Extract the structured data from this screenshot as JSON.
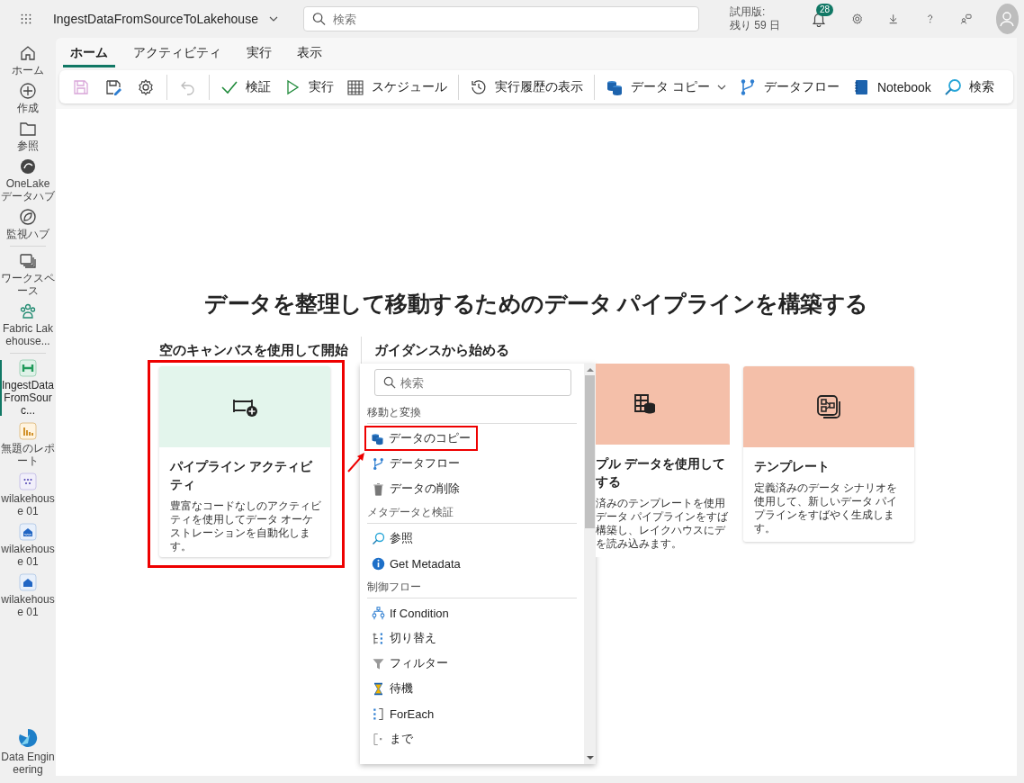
{
  "header": {
    "app_title": "IngestDataFromSourceToLakehouse",
    "search": {
      "placeholder": "検索"
    },
    "trial": [
      "試用版:",
      "残り 59 日"
    ],
    "notifications": "28"
  },
  "sidebar": {
    "items": [
      {
        "label": "ホーム",
        "selected": false
      },
      {
        "label": "作成",
        "selected": false
      },
      {
        "label": "参照",
        "selected": false
      },
      {
        "label": "OneLake データハブ",
        "selected": false
      },
      {
        "label": "監視ハブ",
        "selected": false
      },
      {
        "label": "ワークスペース",
        "selected": false
      },
      {
        "label": "Fabric Lakehouse...",
        "selected": false
      },
      {
        "label": "IngestDataFromSourc...",
        "selected": true
      },
      {
        "label": "無題のレポート",
        "selected": false
      },
      {
        "label": "wilakehouse 01",
        "selected": false
      },
      {
        "label": "wilakehouse 01",
        "selected": false
      },
      {
        "label": "wilakehouse 01",
        "selected": false
      }
    ],
    "footer": {
      "label": "Data Engineering"
    }
  },
  "tabs": [
    {
      "label": "ホーム",
      "selected": true
    },
    {
      "label": "アクティビティ",
      "selected": false
    },
    {
      "label": "実行",
      "selected": false
    },
    {
      "label": "表示",
      "selected": false
    }
  ],
  "toolbar": {
    "icon_buttons": [
      {
        "disabled": true
      },
      {
        "disabled": false
      },
      {
        "disabled": false
      },
      {
        "disabled": true
      }
    ],
    "buttons": [
      {
        "label": "検証",
        "has_menu": false
      },
      {
        "label": "実行",
        "has_menu": false
      },
      {
        "label": "スケジュール",
        "has_menu": false
      },
      {
        "label": "実行履歴の表示",
        "has_menu": false
      },
      {
        "label": "データ コピー",
        "has_menu": true
      },
      {
        "label": "データフロー",
        "has_menu": false
      },
      {
        "label": "Notebook",
        "has_menu": false
      },
      {
        "label": "検索",
        "has_menu": false
      }
    ]
  },
  "canvas": {
    "heading": "データを整理して移動するためのデータ パイプラインを構築する",
    "left_heading": "空のキャンバスを使用して開始",
    "right_heading": "ガイダンスから始める",
    "cards": [
      {
        "title": [
          "パイプライン アクティビティ"
        ],
        "description": [
          "豊富なコードなしのアクティビティを使用してデータ オーケストレーションを自動化します。"
        ],
        "color": "#e3f5ec",
        "highlighted": true,
        "cut": false
      },
      {
        "title": [
          "プル データを使用して",
          "する"
        ],
        "description": [
          "済みのテンプレートを使用",
          "データ パイプラインをすば",
          "構築し、レイクハウスにデ",
          "を読み込みます。"
        ],
        "color": "#f4bfa9",
        "highlighted": false,
        "cut": true
      },
      {
        "title": [
          "テンプレート"
        ],
        "description": [
          "定義済みのデータ シナリオを使用して、新しいデータ パイプラインをすばやく生成します。"
        ],
        "color": "#f4bfa9",
        "highlighted": false,
        "cut": false
      }
    ],
    "activity_menu": {
      "search": {
        "placeholder": "検索"
      },
      "groups": [
        {
          "title": "移動と変換",
          "items": [
            {
              "label": "データのコピー",
              "highlighted": true
            },
            {
              "label": "データフロー",
              "highlighted": false
            },
            {
              "label": "データの削除",
              "highlighted": false
            }
          ]
        },
        {
          "title": "メタデータと検証",
          "items": [
            {
              "label": "参照",
              "highlighted": false
            },
            {
              "label": "Get Metadata",
              "highlighted": false
            }
          ]
        },
        {
          "title": "制御フロー",
          "items": [
            {
              "label": "If Condition",
              "highlighted": false
            },
            {
              "label": "切り替え",
              "highlighted": false
            },
            {
              "label": "フィルター",
              "highlighted": false
            },
            {
              "label": "待機",
              "highlighted": false
            },
            {
              "label": "ForEach",
              "highlighted": false
            },
            {
              "label": "まで",
              "highlighted": false
            }
          ]
        }
      ]
    }
  }
}
